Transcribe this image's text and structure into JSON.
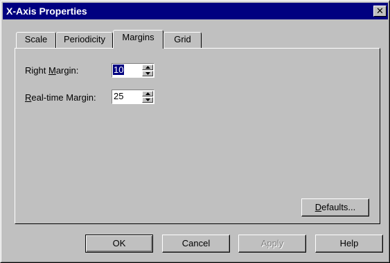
{
  "window": {
    "title": "X-Axis Properties",
    "close_glyph": "✕"
  },
  "tabs": [
    {
      "label": "Scale",
      "active": false
    },
    {
      "label": "Periodicity",
      "active": false
    },
    {
      "label": "Margins",
      "active": true
    },
    {
      "label": "Grid",
      "active": false
    }
  ],
  "margins": {
    "right_margin": {
      "label_pre": "Right ",
      "label_mnemonic": "M",
      "label_post": "argin:",
      "value": "10"
    },
    "realtime_margin": {
      "label_pre": "",
      "label_mnemonic": "R",
      "label_post": "eal-time Margin:",
      "value": "25"
    }
  },
  "buttons": {
    "defaults": {
      "mnemonic": "D",
      "rest": "efaults..."
    },
    "ok": "OK",
    "cancel": "Cancel",
    "apply": "Apply",
    "help": "Help"
  },
  "colors": {
    "titlebar": "#000080",
    "face": "#c0c0c0",
    "selection": "#000080"
  },
  "icons": {
    "spin_up": "up-arrow-icon",
    "spin_down": "down-arrow-icon",
    "close": "close-icon"
  }
}
